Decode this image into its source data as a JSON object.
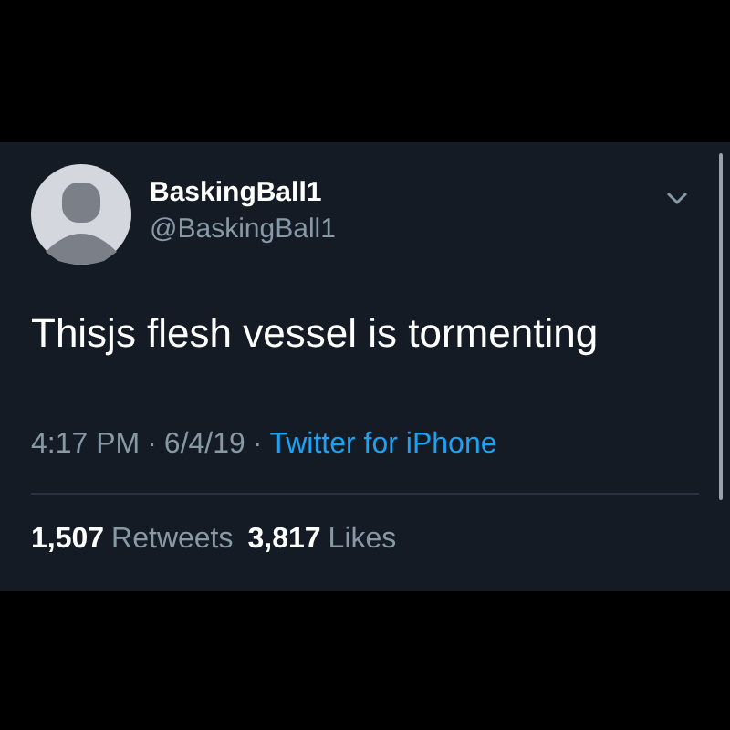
{
  "tweet": {
    "display_name": "BaskingBall1",
    "handle": "@BaskingBall1",
    "text": "Thisjs flesh vessel is tormenting",
    "meta": [
      {
        "kind": "time",
        "text": "4:17 PM"
      },
      {
        "kind": "separator",
        "text": "·"
      },
      {
        "kind": "date",
        "text": "6/4/19"
      },
      {
        "kind": "separator",
        "text": "·"
      },
      {
        "kind": "source",
        "text": "Twitter for iPhone"
      }
    ],
    "stats": [
      {
        "count": "1,507",
        "label": "Retweets"
      },
      {
        "count": "3,817",
        "label": "Likes"
      }
    ]
  }
}
